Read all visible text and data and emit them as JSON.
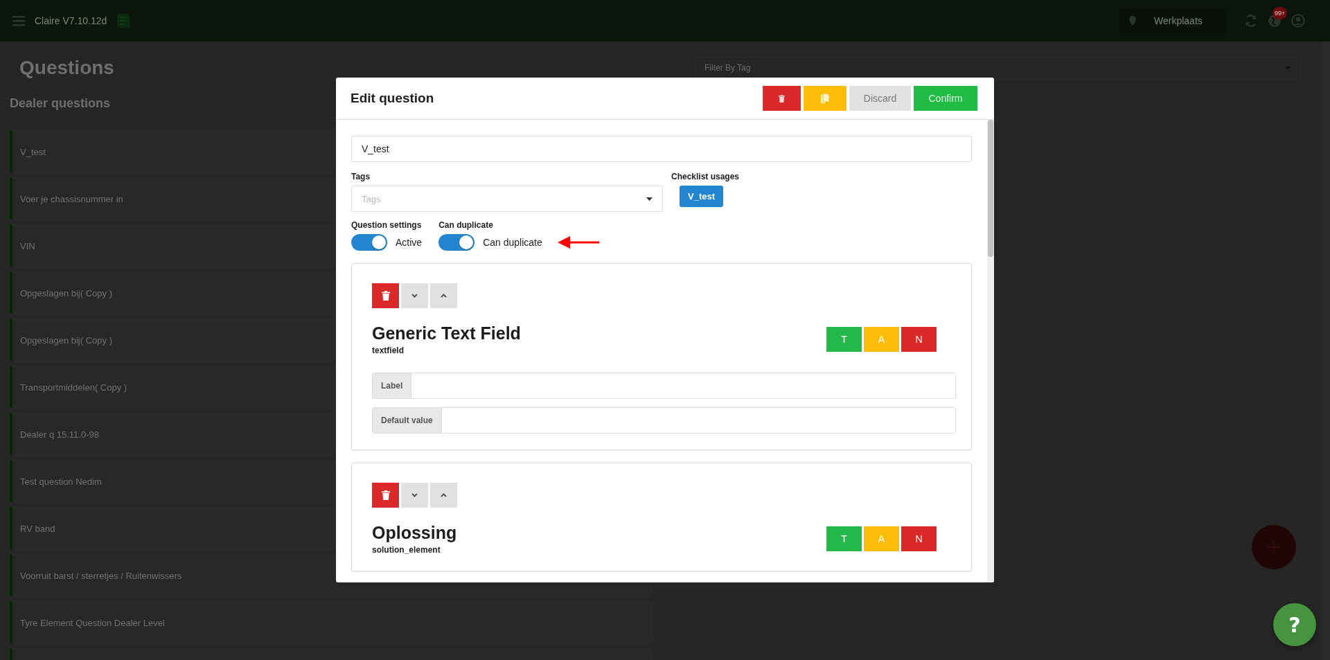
{
  "app_bar": {
    "title": "Claire V7.10.12d",
    "location": "Werkplaats",
    "notification_badge": "99+"
  },
  "page": {
    "title": "Questions",
    "filter": {
      "placeholder": "Filter By Tag"
    },
    "section_title": "Dealer questions",
    "questions": [
      "V_test",
      "Voer je chassisnummer in",
      "VIN",
      "Opgeslagen bij( Copy )",
      "Opgeslagen bij( Copy )",
      "Transportmiddelen( Copy )",
      "Dealer q 15.11.0-98",
      "Test question Nedim",
      "RV band",
      "Voorruit barst / sterretjes / Ruitenwissers",
      "Tyre Element Question Dealer Level"
    ],
    "help_button": "?"
  },
  "dialog": {
    "title": "Edit question",
    "buttons": [
      {
        "kind": "delete"
      },
      {
        "kind": "copy"
      },
      {
        "kind": "discard",
        "label": "Discard"
      },
      {
        "kind": "confirm",
        "label": "Confirm"
      }
    ],
    "name_field": {
      "value": "V_test"
    },
    "tags": {
      "label": "Tags",
      "placeholder": "Tags"
    },
    "checklist_usages": {
      "label": "Checklist usages",
      "chips": [
        "V_test"
      ]
    },
    "toggles": [
      {
        "heading": "Question settings",
        "label": "Active",
        "on": true
      },
      {
        "heading": "Can duplicate",
        "label": "Can duplicate",
        "on": true
      }
    ],
    "elements": [
      {
        "title": "Generic Text Field",
        "type": "textfield",
        "buttons": [
          {
            "label": "T",
            "color": "#22b84a"
          },
          {
            "label": "A",
            "color": "#fbbd08"
          },
          {
            "label": "N",
            "color": "#db2828"
          }
        ],
        "fields": [
          {
            "label": "Label"
          },
          {
            "label": "Default value"
          }
        ]
      },
      {
        "title": "Oplossing",
        "type": "solution_element",
        "buttons": [
          {
            "label": "T",
            "color": "#22b84a"
          },
          {
            "label": "A",
            "color": "#fbbd08"
          },
          {
            "label": "N",
            "color": "#db2828"
          }
        ]
      }
    ]
  }
}
